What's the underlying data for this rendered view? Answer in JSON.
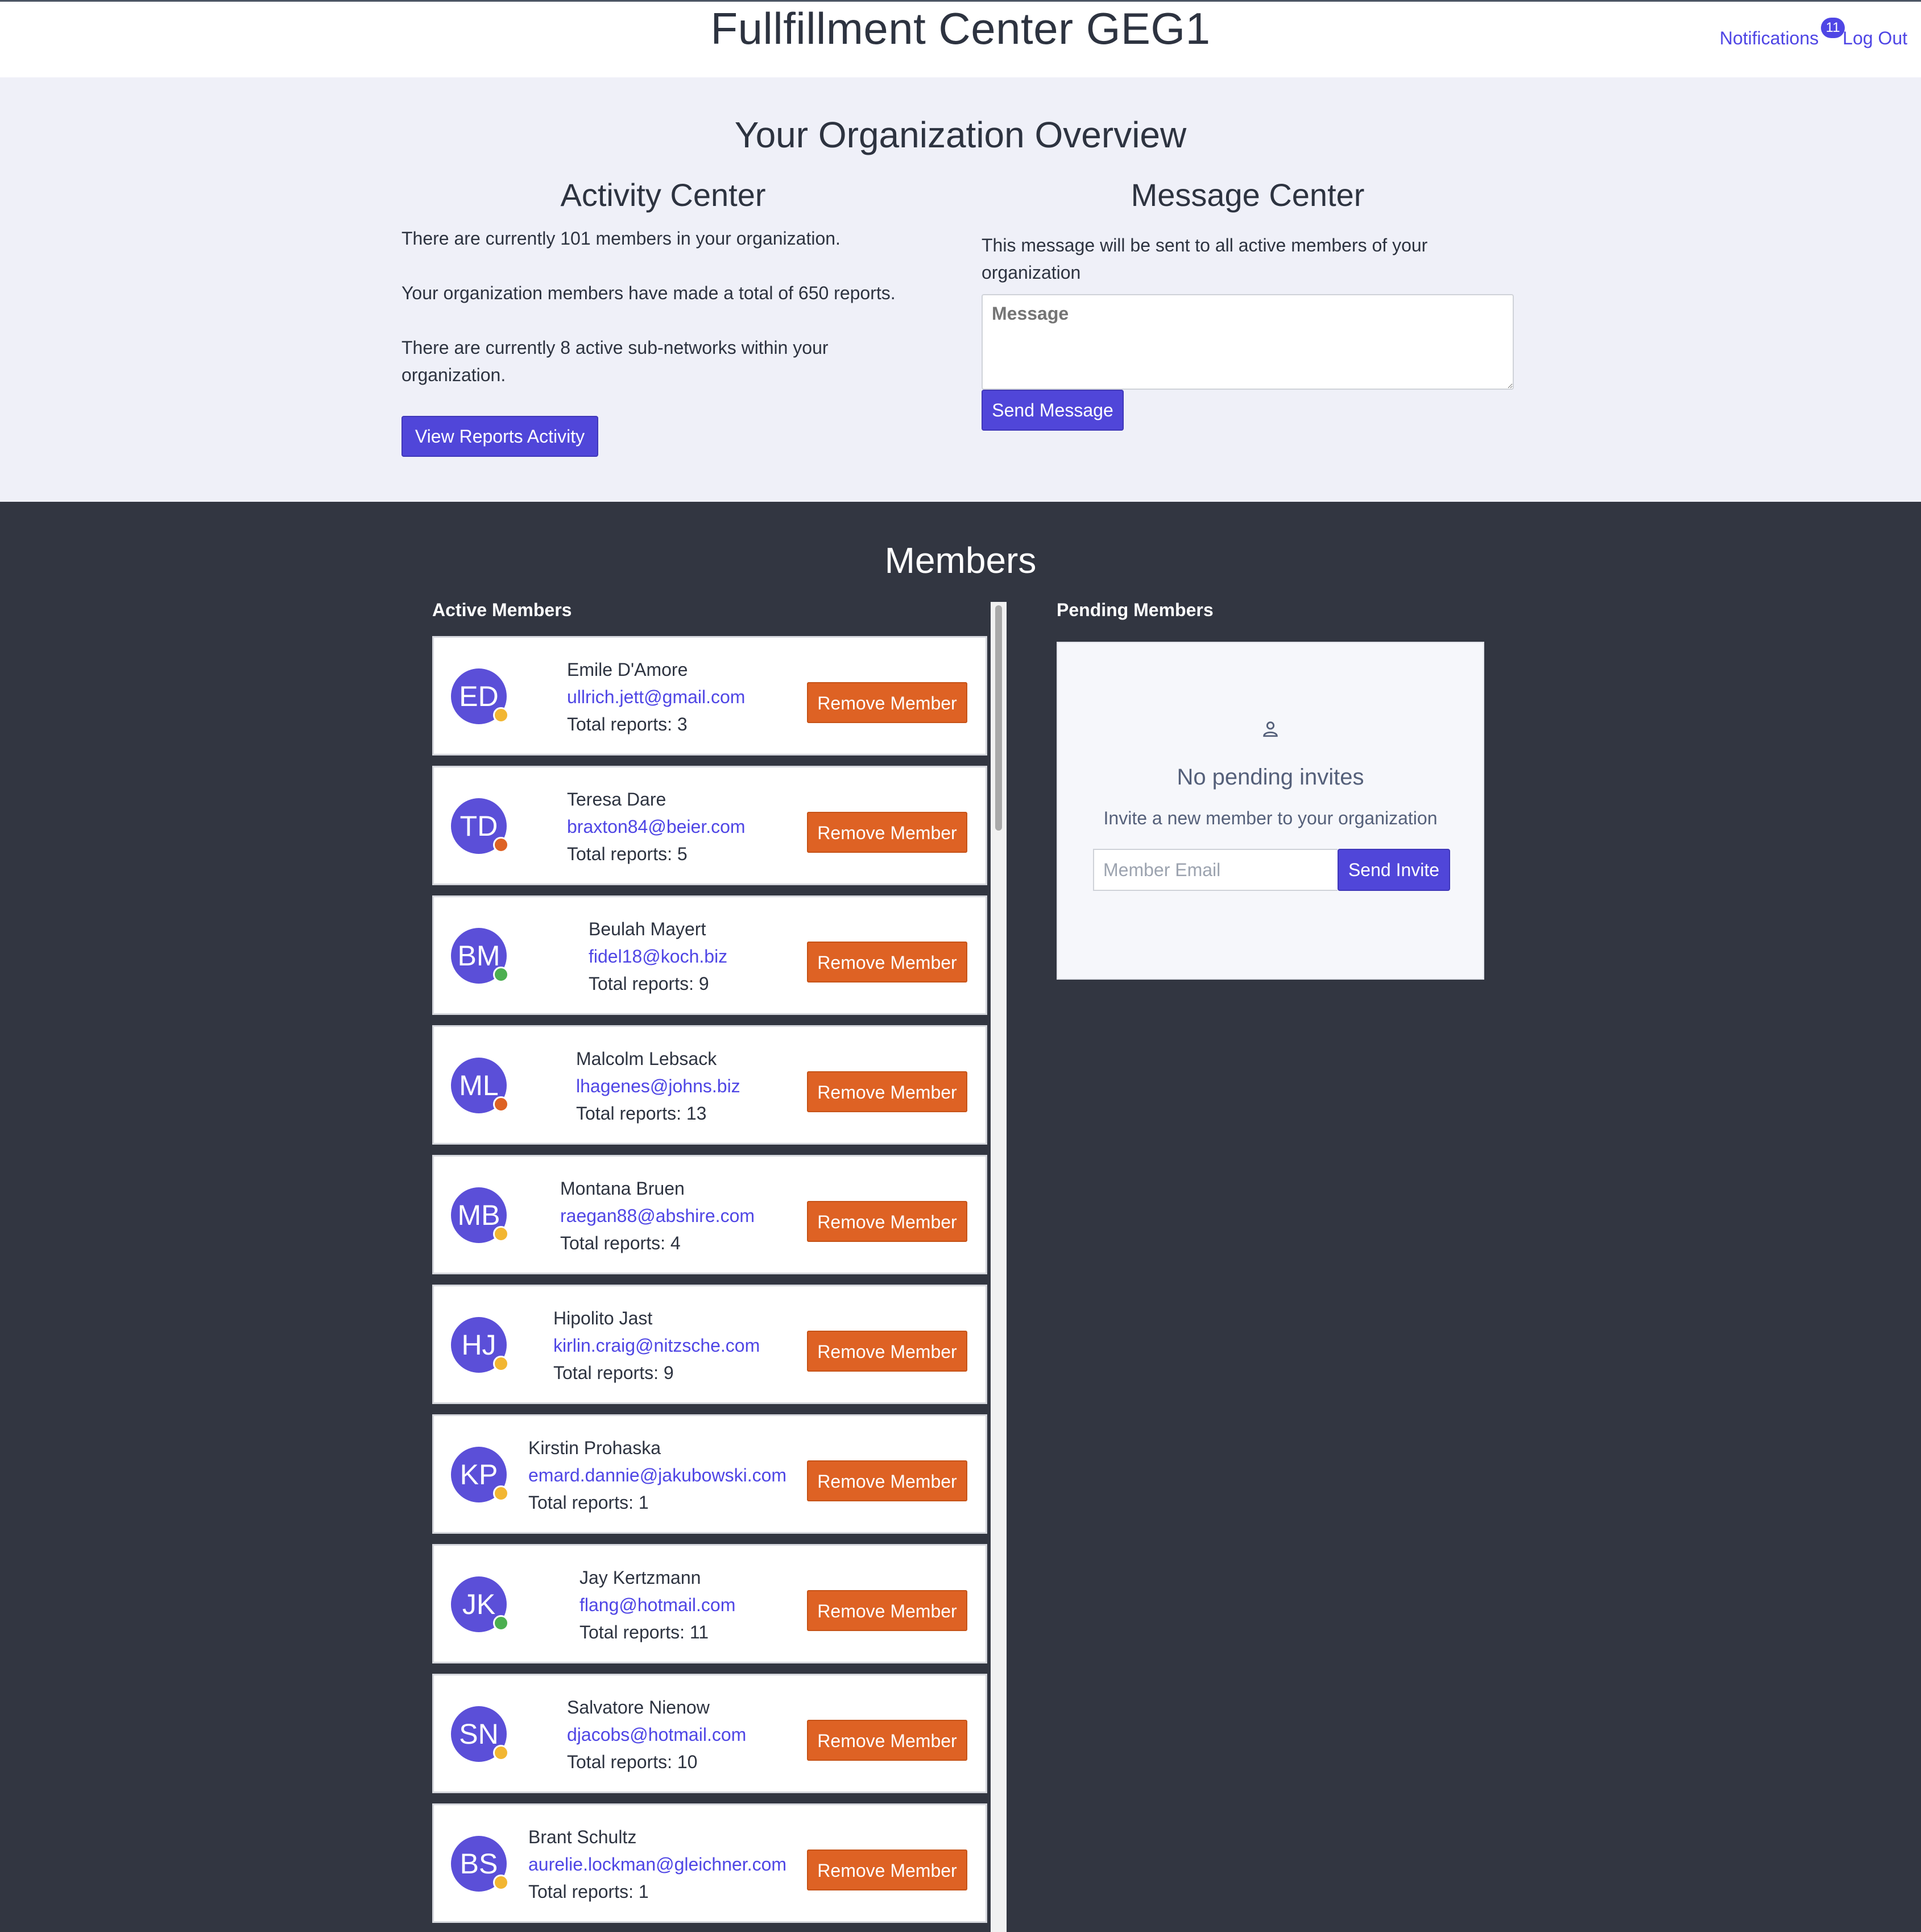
{
  "header": {
    "title": "Fullfillment Center GEG1",
    "notifications_label": "Notifications",
    "notifications_count": "11",
    "logout_label": "Log Out"
  },
  "overview": {
    "title": "Your Organization Overview",
    "activity": {
      "title": "Activity Center",
      "line1": "There are currently 101 members in your organization.",
      "line2": "Your organization members have made a total of 650 reports.",
      "line3": "There are currently 8 active sub-networks within your organization.",
      "button": "View Reports Activity"
    },
    "message": {
      "title": "Message Center",
      "description": "This message will be sent to all active members of your organization",
      "placeholder": "Message",
      "button": "Send Message"
    }
  },
  "members": {
    "title": "Members",
    "active_label": "Active Members",
    "pending_label": "Pending Members",
    "remove_label": "Remove Member",
    "status_colors": {
      "away": "#f2b632",
      "busy": "#de6224",
      "online": "#4caf50"
    },
    "active": [
      {
        "initials": "ED",
        "name": "Emile D'Amore",
        "email": "ullrich.jett@gmail.com",
        "reports": "Total reports: 3",
        "status": "away"
      },
      {
        "initials": "TD",
        "name": "Teresa Dare",
        "email": "braxton84@beier.com",
        "reports": "Total reports: 5",
        "status": "busy"
      },
      {
        "initials": "BM",
        "name": "Beulah Mayert",
        "email": "fidel18@koch.biz",
        "reports": "Total reports: 9",
        "status": "online"
      },
      {
        "initials": "ML",
        "name": "Malcolm Lebsack",
        "email": "lhagenes@johns.biz",
        "reports": "Total reports: 13",
        "status": "busy"
      },
      {
        "initials": "MB",
        "name": "Montana Bruen",
        "email": "raegan88@abshire.com",
        "reports": "Total reports: 4",
        "status": "away"
      },
      {
        "initials": "HJ",
        "name": "Hipolito Jast",
        "email": "kirlin.craig@nitzsche.com",
        "reports": "Total reports: 9",
        "status": "away"
      },
      {
        "initials": "KP",
        "name": "Kirstin Prohaska",
        "email": "emard.dannie@jakubowski.com",
        "reports": "Total reports: 1",
        "status": "away"
      },
      {
        "initials": "JK",
        "name": "Jay Kertzmann",
        "email": "flang@hotmail.com",
        "reports": "Total reports: 11",
        "status": "online"
      },
      {
        "initials": "SN",
        "name": "Salvatore Nienow",
        "email": "djacobs@hotmail.com",
        "reports": "Total reports: 10",
        "status": "away"
      },
      {
        "initials": "BS",
        "name": "Brant Schultz",
        "email": "aurelie.lockman@gleichner.com",
        "reports": "Total reports: 1",
        "status": "away"
      }
    ],
    "pending": {
      "icon": "user-icon",
      "empty_title": "No pending invites",
      "empty_subtitle": "Invite a new member to your organization",
      "email_placeholder": "Member Email",
      "invite_button": "Send Invite"
    }
  }
}
